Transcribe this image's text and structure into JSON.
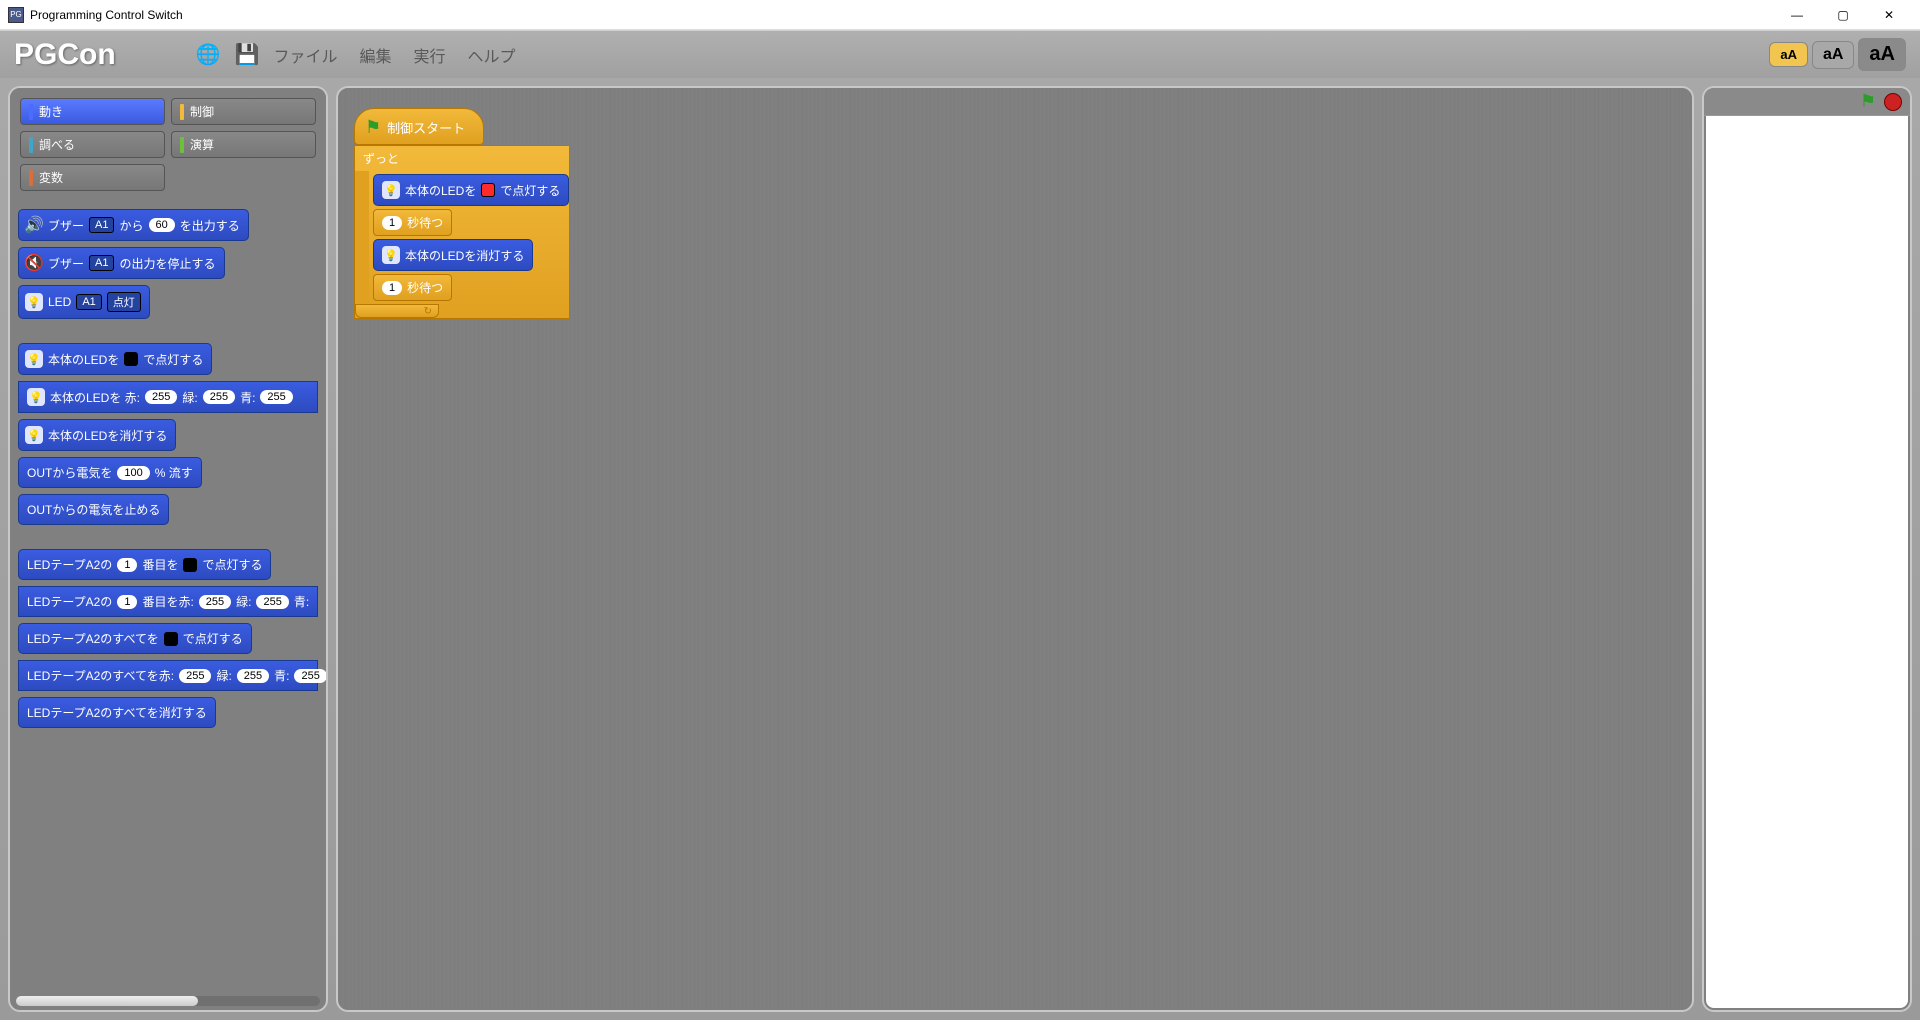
{
  "window": {
    "title": "Programming Control Switch"
  },
  "app": {
    "logo": "PGCon"
  },
  "menu": {
    "file": "ファイル",
    "edit": "編集",
    "run": "実行",
    "help": "ヘルプ"
  },
  "font_btns": {
    "s": "aA",
    "m": "aA",
    "l": "aA"
  },
  "categories": [
    {
      "label": "動き",
      "color": "#4a6cff",
      "active": true
    },
    {
      "label": "制御",
      "color": "#f2b93a",
      "active": false
    },
    {
      "label": "調べる",
      "color": "#3fa6c8",
      "active": false
    },
    {
      "label": "演算",
      "color": "#6fbf3f",
      "active": false
    },
    {
      "label": "変数",
      "color": "#d86f3a",
      "active": false
    }
  ],
  "palette": {
    "buzzer_out_pre": "ブザー",
    "buzzer_out_port": "A1",
    "buzzer_out_mid": "から",
    "buzzer_out_val": "60",
    "buzzer_out_suf": "を出力する",
    "buzzer_stop_pre": "ブザー",
    "buzzer_stop_port": "A1",
    "buzzer_stop_suf": "の出力を停止する",
    "led_pre": "LED",
    "led_port": "A1",
    "led_state": "点灯",
    "body_led_color_pre": "本体のLEDを",
    "body_led_color_suf": "で点灯する",
    "body_led_rgb_pre": "本体のLEDを 赤:",
    "body_led_rgb_g": "緑:",
    "body_led_rgb_b": "青:",
    "rgb255": "255",
    "body_led_off": "本体のLEDを消灯する",
    "out_power_pre": "OUTから電気を",
    "out_power_val": "100",
    "out_power_suf": "% 流す",
    "out_stop": "OUTからの電気を止める",
    "tape_idx_pre": "LEDテープA2の",
    "tape_idx_n": "1",
    "tape_idx_mid": "番目を",
    "tape_idx_suf": "で点灯する",
    "tape_idx_rgb_mid": "番目を赤:",
    "tape_rgb_g": "緑:",
    "tape_rgb_b": "青:",
    "tape_all_pre": "LEDテープA2のすべてを",
    "tape_all_suf": "で点灯する",
    "tape_all_rgb_pre": "LEDテープA2のすべてを赤:",
    "tape_all_off": "LEDテープA2のすべてを消灯する"
  },
  "script": {
    "hat": "制御スタート",
    "forever": "ずっと",
    "led_on_pre": "本体のLEDを",
    "led_on_suf": "で点灯する",
    "wait_n": "1",
    "wait_suf": "秒待つ",
    "led_off": "本体のLEDを消灯する"
  }
}
